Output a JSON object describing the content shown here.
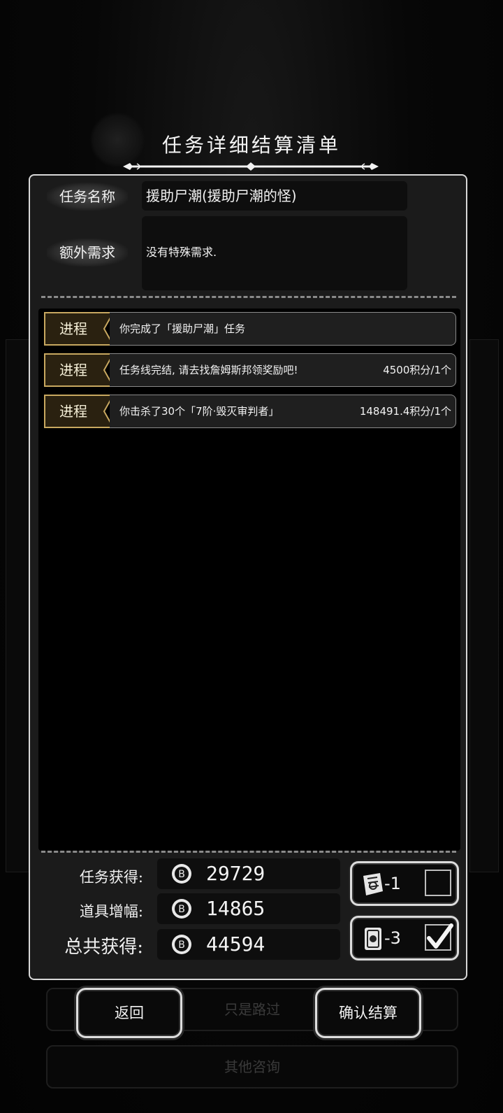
{
  "title": "任务详细结算清单",
  "info": {
    "name_label": "任务名称",
    "name_value": "援助尸潮(援助尸潮的怪)",
    "extra_label": "额外需求",
    "extra_value": "没有特殊需求."
  },
  "rows": [
    {
      "tag": "进程",
      "text": "你完成了「援助尸潮」任务",
      "reward": ""
    },
    {
      "tag": "进程",
      "text": "任务线完结, 请去找詹姆斯邦领奖励吧!",
      "reward": "4500积分/1个"
    },
    {
      "tag": "进程",
      "text": "你击杀了30个「7阶·毁灭审判者」",
      "reward": "148491.4积分/1个"
    }
  ],
  "earnings": {
    "task_label": "任务获得:",
    "task_value": "29729",
    "item_label": "道具增幅:",
    "item_value": "14865",
    "total_label": "总共获得:",
    "total_value": "44594"
  },
  "items": [
    {
      "icon": "scroll-icon",
      "count": "-1",
      "checked": false
    },
    {
      "icon": "card-icon",
      "count": "-3",
      "checked": true
    }
  ],
  "actions": {
    "back_label": "返回",
    "confirm_label": "确认结算"
  },
  "background": {
    "pass_label": "只是路过",
    "other_label": "其他咨询"
  }
}
